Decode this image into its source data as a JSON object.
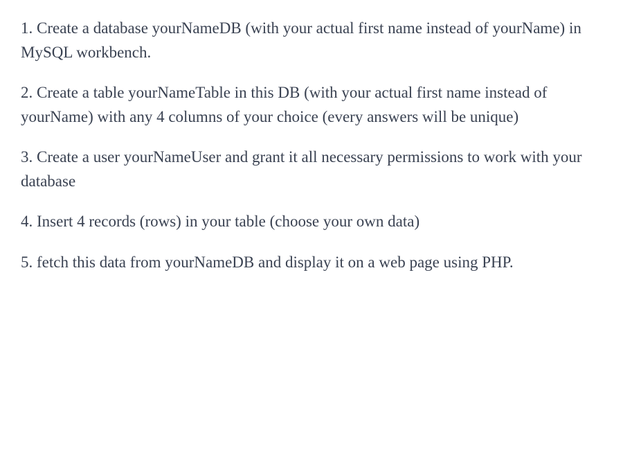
{
  "instructions": {
    "item1": "1. Create a database yourNameDB (with your actual first name instead of yourName) in MySQL workbench.",
    "item2": "2. Create a table yourNameTable in this DB (with your actual first name instead of yourName) with any 4 columns of your choice (every answers will be unique)",
    "item3": "3. Create a user yourNameUser and grant it all necessary permissions to work with your database",
    "item4": "4. Insert 4 records (rows) in your table (choose your own data)",
    "item5": "5. fetch this data from yourNameDB and display it on a web page using PHP."
  }
}
